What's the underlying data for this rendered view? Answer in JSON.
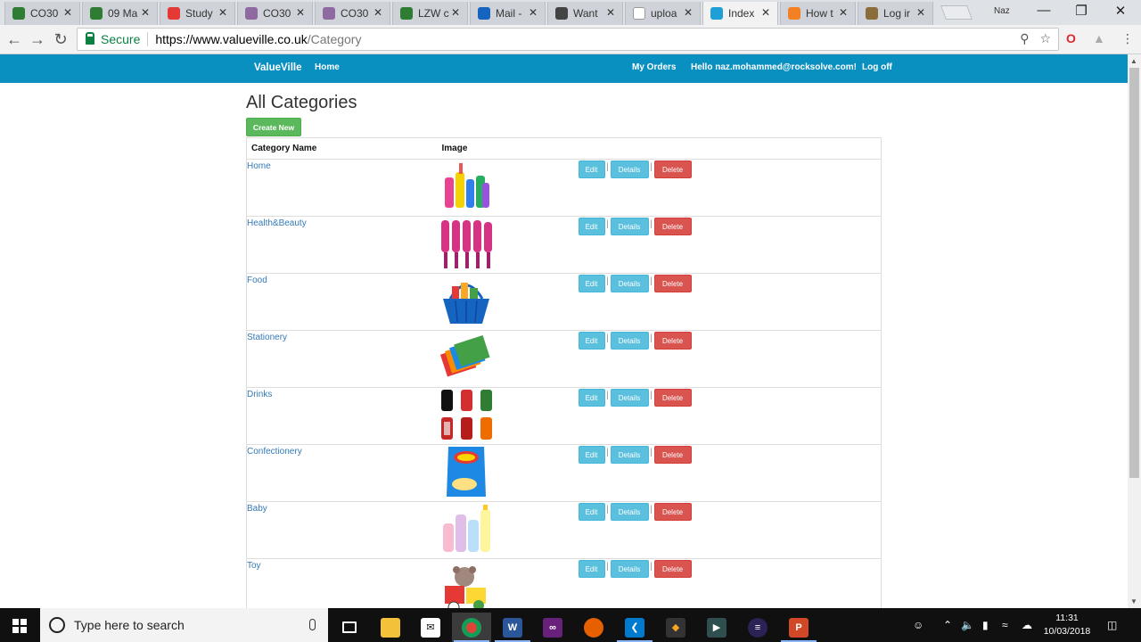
{
  "browser": {
    "tabs": [
      {
        "title": "CO30",
        "fav_color": "#2e7d32"
      },
      {
        "title": "09 Ma",
        "fav_color": "#2e7d32"
      },
      {
        "title": "Study",
        "fav_color": "#e53935"
      },
      {
        "title": "CO30",
        "fav_color": "#8e6aa0"
      },
      {
        "title": "CO30",
        "fav_color": "#8e6aa0"
      },
      {
        "title": "LZW c",
        "fav_color": "#2e7d32"
      },
      {
        "title": "Mail -",
        "fav_color": "#1565c0"
      },
      {
        "title": "Want",
        "fav_color": "#444444"
      },
      {
        "title": "uploa",
        "fav_color": "#ffffff"
      },
      {
        "title": "Index",
        "fav_color": "#1ea0d6"
      },
      {
        "title": "How t",
        "fav_color": "#f48024"
      },
      {
        "title": "Log ir",
        "fav_color": "#8a6d3b"
      }
    ],
    "active_tab_index": 9,
    "window_user": "Naz",
    "security_label": "Secure",
    "url_host": "https://www.valueville.co.uk",
    "url_path": "/Category"
  },
  "site": {
    "brand": "ValueVille",
    "nav_home": "Home",
    "nav_orders": "My Orders",
    "nav_greeting": "Hello naz.mohammed@rocksolve.com!",
    "nav_logoff": "Log off"
  },
  "page": {
    "title": "All Categories",
    "create_label": "Create New",
    "col_name": "Category Name",
    "col_image": "Image",
    "edit_label": "Edit",
    "details_label": "Details",
    "delete_label": "Delete",
    "pipe": "|",
    "categories": [
      {
        "name": "Home",
        "image_icon": "cleaning-products-icon"
      },
      {
        "name": "Health&Beauty",
        "image_icon": "hairbrushes-icon"
      },
      {
        "name": "Food",
        "image_icon": "shopping-basket-icon"
      },
      {
        "name": "Stationery",
        "image_icon": "notebooks-icon"
      },
      {
        "name": "Drinks",
        "image_icon": "drink-cans-icon"
      },
      {
        "name": "Confectionery",
        "image_icon": "crisps-packet-icon"
      },
      {
        "name": "Baby",
        "image_icon": "baby-toiletries-icon"
      },
      {
        "name": "Toy",
        "image_icon": "toys-icon"
      }
    ]
  },
  "taskbar": {
    "search_placeholder": "Type here to search",
    "time": "11:31",
    "date": "10/03/2018"
  }
}
